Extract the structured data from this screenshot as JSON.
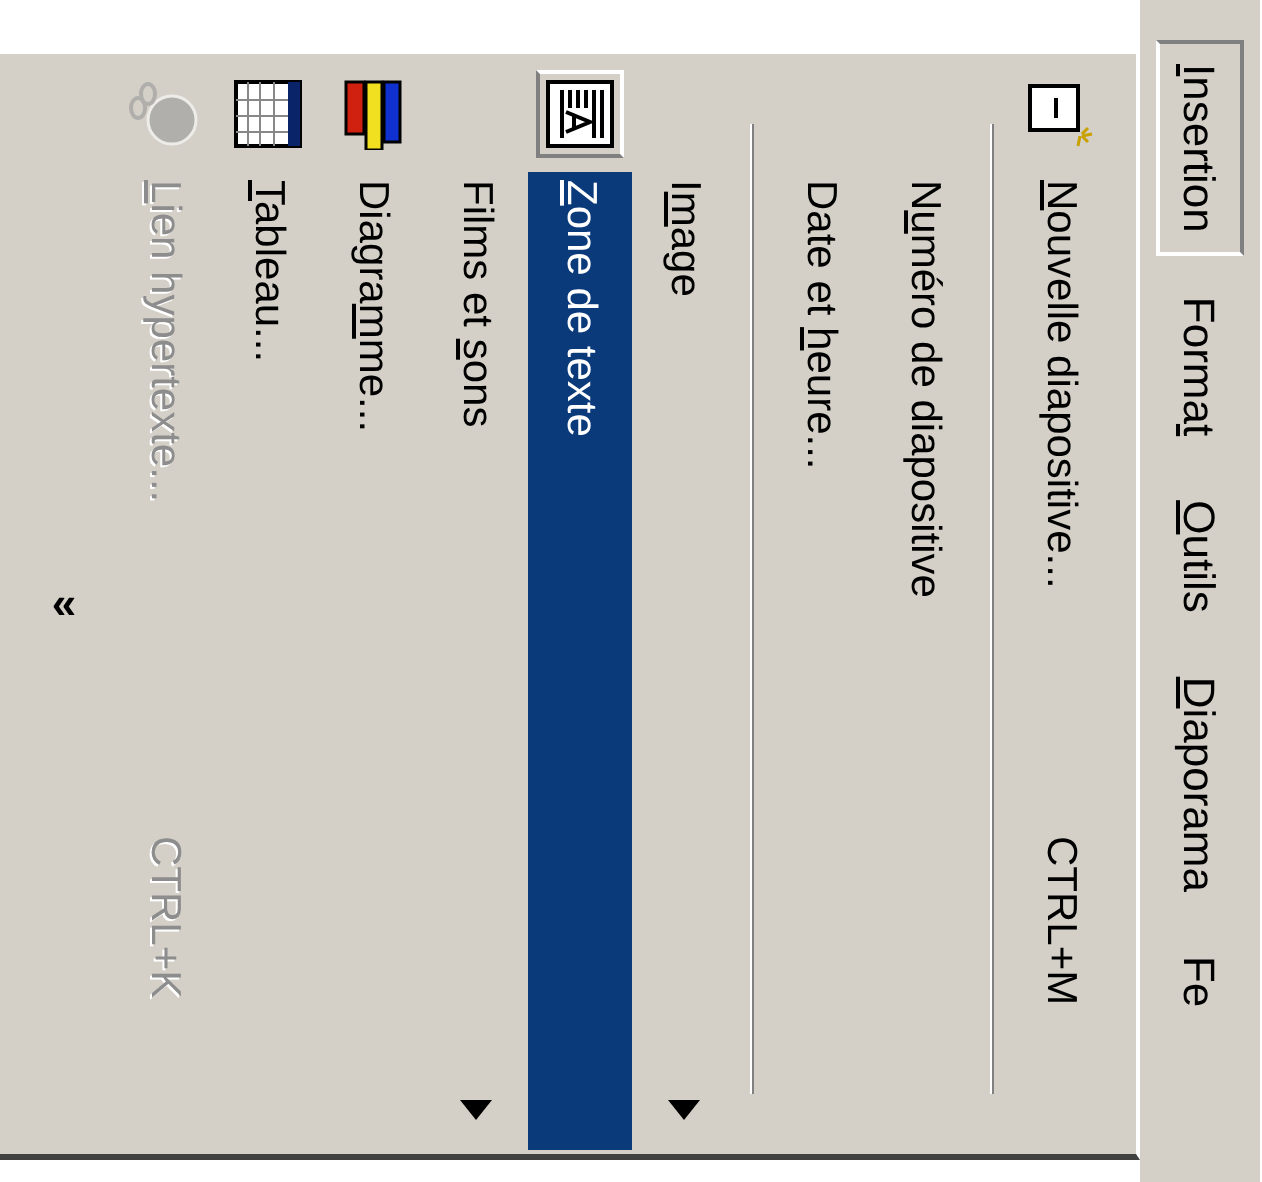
{
  "menu_bar": [
    {
      "mnemonic": "I",
      "text_after": "nsertion",
      "selected": true
    },
    {
      "text_before": "Forma",
      "mnemonic": "t",
      "selected": false
    },
    {
      "mnemonic": "O",
      "text_after": "utils",
      "selected": false
    },
    {
      "mnemonic": "D",
      "text_after": "iaporama",
      "selected": false
    },
    {
      "text_before": "Fe",
      "selected": false
    }
  ],
  "menu": {
    "items": [
      {
        "kind": "command",
        "mnemonic": "N",
        "text_after": "ouvelle diapositive...",
        "shortcut": "CTRL+M",
        "selected": false,
        "disabled": false
      },
      {
        "kind": "separator"
      },
      {
        "kind": "command",
        "text_before": "N",
        "mnemonic": "u",
        "text_after": "méro de diapositive",
        "selected": false,
        "disabled": false
      },
      {
        "kind": "command",
        "text_before": "Date et ",
        "mnemonic": "h",
        "text_after": "eure...",
        "selected": false,
        "disabled": false
      },
      {
        "kind": "separator"
      },
      {
        "kind": "submenu",
        "text_before": "I",
        "mnemonic": "m",
        "text_after": "age",
        "selected": false,
        "disabled": false
      },
      {
        "kind": "command",
        "mnemonic": "Z",
        "text_after": "one de texte",
        "selected": true,
        "disabled": false
      },
      {
        "kind": "submenu",
        "text_before": "Films et ",
        "mnemonic": "s",
        "text_after": "ons",
        "selected": false,
        "disabled": false
      },
      {
        "kind": "command",
        "text_before": "Diagra",
        "mnemonic": "m",
        "text_after": "me...",
        "selected": false,
        "disabled": false
      },
      {
        "kind": "command",
        "mnemonic": "T",
        "text_after": "ableau...",
        "selected": false,
        "disabled": false
      },
      {
        "kind": "command",
        "mnemonic": "L",
        "text_after": "ien hypertexte...",
        "shortcut": "CTRL+K",
        "selected": false,
        "disabled": true
      }
    ],
    "expand": "«"
  }
}
